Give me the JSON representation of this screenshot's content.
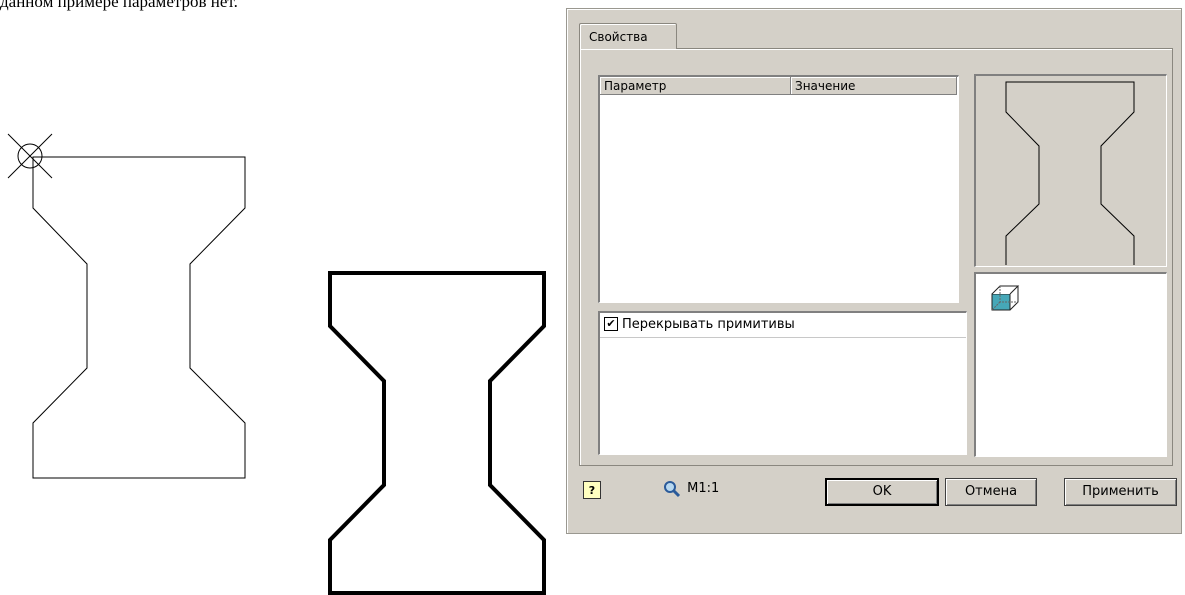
{
  "document": {
    "visible_text": "данном примере параметров нет."
  },
  "dialog": {
    "tab_label": "Свойства",
    "table": {
      "columns": [
        "Параметр",
        "Значение"
      ]
    },
    "overlap_option": {
      "label": "Перекрывать примитивы",
      "checked": true
    },
    "preview_icon": "cube-icon",
    "help_icon": "help-icon",
    "scale_label": "М1:1",
    "buttons": {
      "ok": "OK",
      "cancel": "Отмена",
      "apply": "Применить"
    }
  }
}
